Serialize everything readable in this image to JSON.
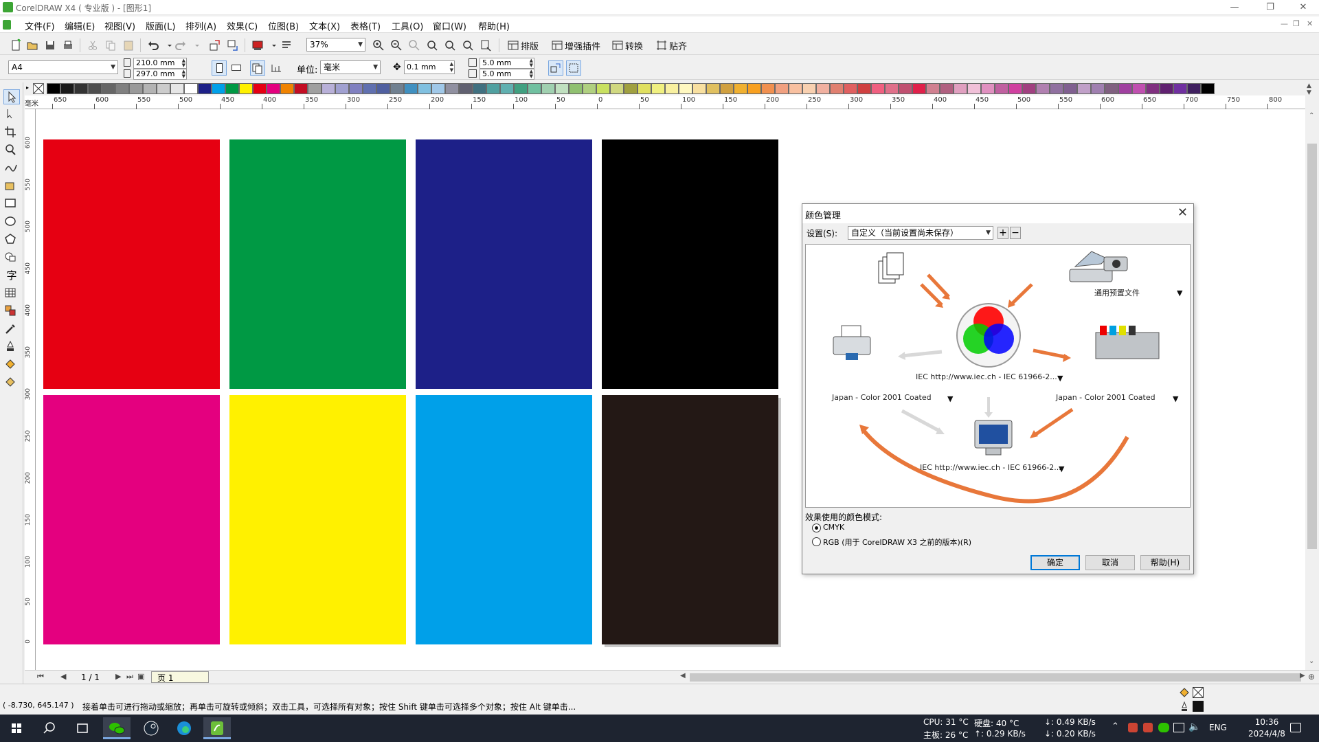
{
  "window": {
    "title": "CorelDRAW X4 ( 专业版 ) - [图形1]",
    "controls": [
      "—",
      "❐",
      "✕"
    ],
    "doc_controls": [
      "—",
      "❐",
      "✕"
    ]
  },
  "menu": [
    "文件(F)",
    "编辑(E)",
    "视图(V)",
    "版面(L)",
    "排列(A)",
    "效果(C)",
    "位图(B)",
    "文本(X)",
    "表格(T)",
    "工具(O)",
    "窗口(W)",
    "帮助(H)"
  ],
  "toolbar": {
    "zoom": "37%",
    "layout_label": "排版",
    "plugins_label": "增强插件",
    "convert_label": "转换",
    "snap_label": "贴齐"
  },
  "propbar": {
    "paper": "A4",
    "width": "210.0 mm",
    "height": "297.0 mm",
    "unit_label": "单位:",
    "unit": "毫米",
    "nudge": "0.1 mm",
    "dup_x": "5.0 mm",
    "dup_y": "5.0 mm"
  },
  "palette_colors": [
    "#000000",
    "#1a1a1a",
    "#333333",
    "#4d4d4d",
    "#666666",
    "#808080",
    "#999999",
    "#b3b3b3",
    "#cccccc",
    "#e6e6e6",
    "#ffffff",
    "#1d2088",
    "#00a0e9",
    "#009944",
    "#fff100",
    "#e60012",
    "#e4007f",
    "#f08300",
    "#c30d23",
    "#a0a0a0",
    "#b8b0d8",
    "#a0a0d0",
    "#8080c0",
    "#6070b0",
    "#5060a0",
    "#708090",
    "#4090c0",
    "#80c0e0",
    "#a0c8e8",
    "#9090a0",
    "#606070",
    "#407080",
    "#50a0a0",
    "#60b0b0",
    "#40a080",
    "#70c0a0",
    "#a0d0b0",
    "#c0e0c0",
    "#90c070",
    "#b0d080",
    "#c8e060",
    "#d0d880",
    "#a0a040",
    "#e0e060",
    "#f0f080",
    "#f8f0a0",
    "#fff8c0",
    "#f8e0a0",
    "#e0c060",
    "#d0a040",
    "#f0b030",
    "#f8a020",
    "#f09050",
    "#f0a080",
    "#f8c0a0",
    "#f8d0b0",
    "#f0b0a0",
    "#e08070",
    "#e06060",
    "#d04040",
    "#f06080",
    "#e0708a",
    "#c05070",
    "#e0204a",
    "#d08090",
    "#b06080",
    "#e0a0c0",
    "#f0c0d8",
    "#e090c0",
    "#c060a0",
    "#d040a0",
    "#a04080",
    "#b080b0",
    "#9070a0",
    "#806090",
    "#c0a0c8",
    "#a080b0",
    "#806080",
    "#a040a0",
    "#c050b0",
    "#803080",
    "#602070",
    "#7030a0",
    "#402060",
    "#000000"
  ],
  "ruler_h": [
    "650",
    "600",
    "550",
    "500",
    "450",
    "400",
    "350",
    "300",
    "250",
    "200",
    "150",
    "100",
    "50",
    "0",
    "50",
    "100",
    "150",
    "200",
    "250",
    "300",
    "350",
    "400",
    "450",
    "500",
    "550",
    "600",
    "650",
    "700",
    "750",
    "800"
  ],
  "ruler_h_unit": "毫米",
  "ruler_v": [
    "600",
    "550",
    "500",
    "450",
    "400",
    "350",
    "300",
    "250",
    "200",
    "150",
    "100",
    "50",
    "0"
  ],
  "canvas_swatches": [
    {
      "name": "red",
      "color": "#e60012"
    },
    {
      "name": "green",
      "color": "#009944"
    },
    {
      "name": "blue",
      "color": "#1d2088"
    },
    {
      "name": "black",
      "color": "#000000"
    },
    {
      "name": "magenta",
      "color": "#e4007f"
    },
    {
      "name": "yellow",
      "color": "#fff100"
    },
    {
      "name": "cyan",
      "color": "#00a0e9"
    },
    {
      "name": "rich-black",
      "color": "#231815"
    }
  ],
  "page_nav": {
    "counter": "1 / 1",
    "tab": "页 1"
  },
  "status": {
    "coords": "( -8.730, 645.147 )",
    "hint": "接着单击可进行拖动或缩放；再单击可旋转或倾斜；双击工具，可选择所有对象；按住 Shift 键单击可选择多个对象；按住 Alt 键单击..."
  },
  "dialog": {
    "title": "颜色管理",
    "settings_label": "设置(S):",
    "settings_value": "自定义（当前设置尚未保存）",
    "generic_profile": "通用预置文件",
    "monitor_profile_top": "IEC http://www.iec.ch - IEC 61966-2...",
    "printer_left": "Japan - Color 2001 Coated",
    "printer_right": "Japan - Color 2001 Coated",
    "monitor_profile_bottom": "IEC http://www.iec.ch - IEC 61966-2...",
    "effects_label": "效果使用的颜色模式:",
    "opt_cmyk": "CMYK",
    "opt_rgb": "RGB (用于 CorelDRAW X3 之前的版本)(R)",
    "ok": "确定",
    "cancel": "取消",
    "help": "帮助(H)"
  },
  "taskbar": {
    "cpu": "CPU: 31 °C",
    "board": "主板: 26 °C",
    "disk": "硬盘: 40 °C",
    "upload": "↑: 0.29 KB/s",
    "download": "↓: 0.49 KB/s",
    "net_down": "↓: 0.20 KB/s",
    "lang": "ENG",
    "time": "10:36",
    "date": "2024/4/8"
  }
}
